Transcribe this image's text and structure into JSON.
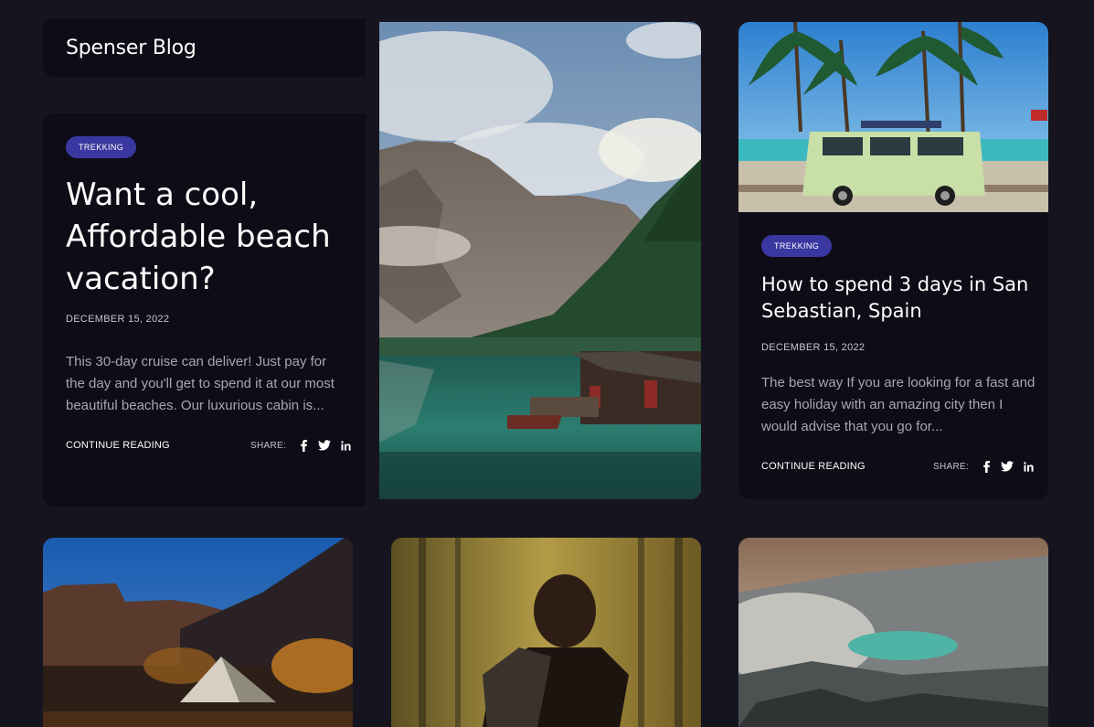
{
  "blog": {
    "title": "Spenser Blog"
  },
  "featured": {
    "tag": "TREKKING",
    "title_lines": [
      "Want a cool,",
      "Affordable beach",
      "vacation?"
    ],
    "date": "DECEMBER 15, 2022",
    "excerpt_lines": [
      "This 30-day cruise can deliver! Just pay for",
      "the day and you'll get to spend it at our most",
      "beautiful beaches. Our luxurious cabin is..."
    ],
    "continue_label": "CONTINUE READING",
    "share_label": "SHARE:"
  },
  "post2": {
    "tag": "TREKKING",
    "title_lines": [
      "How to spend 3 days in San",
      "Sebastian, Spain"
    ],
    "date": "DECEMBER 15, 2022",
    "excerpt_lines": [
      "The best way If you are looking for a fast and",
      "easy holiday with an amazing city then I",
      "would advise that you go for..."
    ],
    "continue_label": "CONTINUE READING",
    "share_label": "SHARE:"
  },
  "share_icons": [
    "facebook-icon",
    "twitter-icon",
    "linkedin-icon"
  ],
  "colors": {
    "background": "#16141f",
    "card": "#0e0c16",
    "tag": "#3a37a0",
    "muted_text": "#a8a6b6"
  }
}
